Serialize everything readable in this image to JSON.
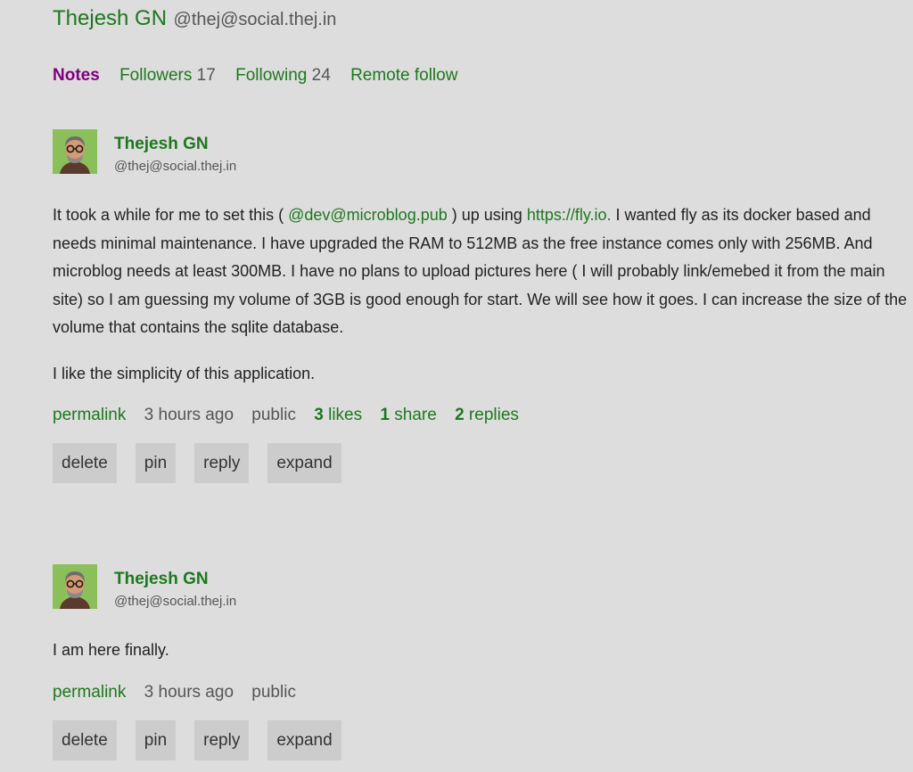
{
  "profile": {
    "name": "Thejesh GN",
    "handle": "@thej@social.thej.in"
  },
  "nav": [
    {
      "label": "Notes",
      "count": "",
      "active": true
    },
    {
      "label": "Followers",
      "count": "17",
      "active": false
    },
    {
      "label": "Following",
      "count": "24",
      "active": false
    },
    {
      "label": "Remote follow",
      "count": "",
      "active": false
    }
  ],
  "notes": [
    {
      "author": {
        "name": "Thejesh GN",
        "handle": "@thej@social.thej.in"
      },
      "content": {
        "p1_a": "It took a while for me to set this ( ",
        "mention": "@dev@microblog.pub",
        "p1_b": " ) up using ",
        "link": "https://fly.io.",
        "p1_c": " I wanted fly as its docker based and needs minimal maintenance. I have upgraded the RAM to 512MB as the free instance comes only with 256MB. And microblog needs at least 300MB. I have no plans to upload pictures here ( I will probably link/emebed it from the main site) so I am guessing my volume of 3GB is good enough for start. We will see how it goes. I can increase the size of the volume that contains the sqlite database.",
        "p2": "I like the simplicity of this application."
      },
      "meta": {
        "permalink": "permalink",
        "time": "3 hours ago",
        "visibility": "public",
        "likes_count": "3",
        "likes_label": "likes",
        "shares_count": "1",
        "shares_label": "share",
        "replies_count": "2",
        "replies_label": "replies"
      },
      "actions": {
        "delete": "delete",
        "pin": "pin",
        "reply": "reply",
        "expand": "expand"
      }
    },
    {
      "author": {
        "name": "Thejesh GN",
        "handle": "@thej@social.thej.in"
      },
      "content": {
        "p1": "I am here finally."
      },
      "meta": {
        "permalink": "permalink",
        "time": "3 hours ago",
        "visibility": "public"
      },
      "actions": {
        "delete": "delete",
        "pin": "pin",
        "reply": "reply",
        "expand": "expand"
      }
    }
  ],
  "colors": {
    "background": "#dddddd",
    "link": "#1d781d",
    "active_nav": "#800080",
    "button_bg": "#cccccc",
    "muted_text": "#555555"
  },
  "icons": {
    "avatar": "avatar-image"
  }
}
